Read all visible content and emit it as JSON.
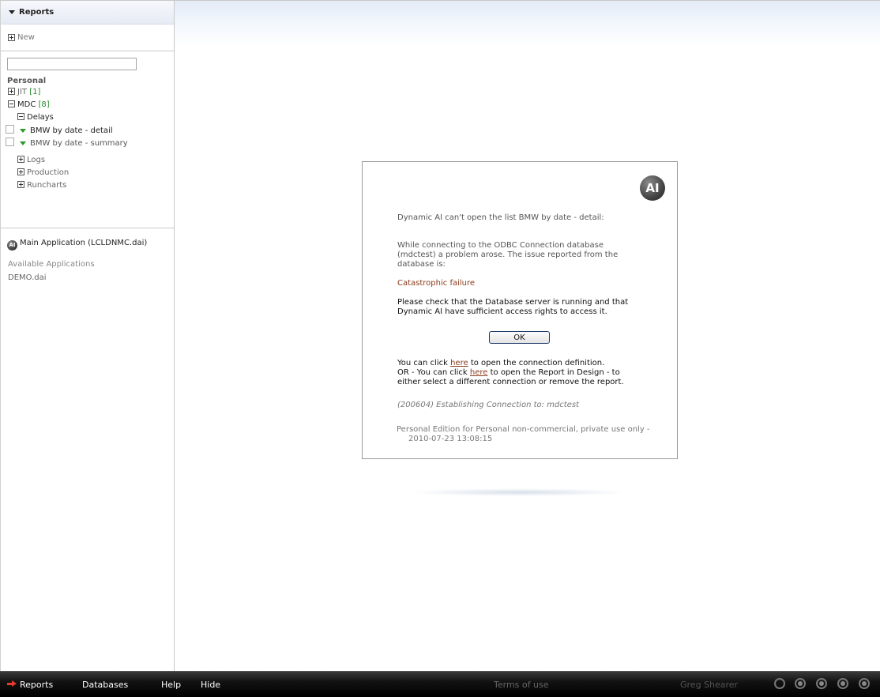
{
  "sidebar": {
    "header": "Reports",
    "new_label": "New",
    "search_value": "",
    "section_personal": "Personal",
    "tree": {
      "jit_label": "JIT",
      "jit_count": "[1]",
      "mdc_label": "MDC",
      "mdc_count": "[8]",
      "delays_label": "Delays",
      "report1": "BMW by date - detail",
      "report2": "BMW by date - summary",
      "logs": "Logs",
      "production": "Production",
      "runcharts": "Runcharts"
    },
    "app_logo": "AI",
    "main_app": "Main Application (LCLDNMC.dai)",
    "available_apps_label": "Available Applications",
    "demo_app": "DEMO.dai"
  },
  "dialog": {
    "logo": "AI",
    "line1": "Dynamic AI can't open the list BMW by date - detail:",
    "para1": "While connecting to the ODBC Connection database (mdctest) a problem arose. The issue reported from the database is:",
    "error": "Catastrophic failure",
    "para2": "Please check that the Database server is running and that Dynamic AI have sufficient access rights to access it.",
    "ok_label": "OK",
    "link_a_pre": "You can click ",
    "link_a": "here",
    "link_a_post": " to open the connection definition.",
    "link_b_pre": "OR - You can click ",
    "link_b": "here",
    "link_b_post": " to open the Report in Design - to either select a different connection or remove the report.",
    "status_line": "(200604) Establishing Connection to: mdctest",
    "edition_line1": "Personal Edition for Personal non-commercial, private use only -",
    "edition_line2": "2010-07-23 13:08:15"
  },
  "bottombar": {
    "reports": "Reports",
    "databases": "Databases",
    "help": "Help",
    "hide": "Hide",
    "terms": "Terms of use",
    "user": "Greg Shearer"
  },
  "icons": [
    "arrow-right-icon",
    "circle-icon",
    "ai-logo-icon",
    "expand-icon",
    "collapse-icon"
  ]
}
